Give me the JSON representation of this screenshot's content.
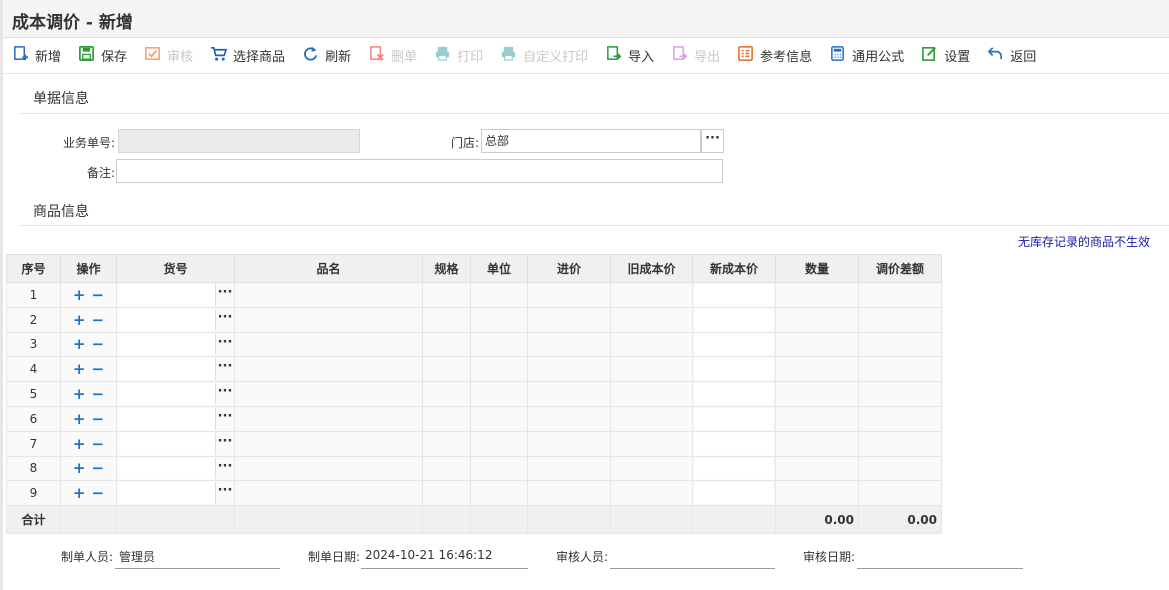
{
  "window": {
    "title": "成本调价 - 新增"
  },
  "toolbar": [
    {
      "label": "新增",
      "icon": "add-doc-icon",
      "color": "#2a6ebd",
      "disabled": false
    },
    {
      "label": "保存",
      "icon": "save-icon",
      "color": "#2e9a3c",
      "disabled": false
    },
    {
      "label": "审核",
      "icon": "audit-icon",
      "color": "#f0a070",
      "disabled": true
    },
    {
      "label": "选择商品",
      "icon": "cart-icon",
      "color": "#2a5fb0",
      "disabled": false
    },
    {
      "label": "刷新",
      "icon": "refresh-icon",
      "color": "#2a6ebd",
      "disabled": false
    },
    {
      "label": "删单",
      "icon": "delete-doc-icon",
      "color": "#e88",
      "disabled": true
    },
    {
      "label": "打印",
      "icon": "print-icon",
      "color": "#9cc",
      "disabled": true
    },
    {
      "label": "自定义打印",
      "icon": "custom-print-icon",
      "color": "#9cc",
      "disabled": true
    },
    {
      "label": "导入",
      "icon": "import-icon",
      "color": "#2e9a3c",
      "disabled": false
    },
    {
      "label": "导出",
      "icon": "export-icon",
      "color": "#d9a0e8",
      "disabled": true
    },
    {
      "label": "参考信息",
      "icon": "reference-icon",
      "color": "#e06a2a",
      "disabled": false
    },
    {
      "label": "通用公式",
      "icon": "formula-icon",
      "color": "#2a6ebd",
      "disabled": false
    },
    {
      "label": "设置",
      "icon": "settings-icon",
      "color": "#2e9a3c",
      "disabled": false
    },
    {
      "label": "返回",
      "icon": "return-icon",
      "color": "#2a6ebd",
      "disabled": false
    }
  ],
  "doc": {
    "section_title": "单据信息",
    "order_no_label": "业务单号:",
    "order_no": "",
    "store_label": "门店:",
    "store": "总部",
    "remark_label": "备注:",
    "remark": ""
  },
  "goods": {
    "section_title": "商品信息",
    "note": "无库存记录的商品不生效",
    "columns": [
      "序号",
      "操作",
      "货号",
      "品名",
      "规格",
      "单位",
      "进价",
      "旧成本价",
      "新成本价",
      "数量",
      "调价差额"
    ],
    "rows": [
      "1",
      "2",
      "3",
      "4",
      "5",
      "6",
      "7",
      "8",
      "9"
    ],
    "total_label": "合计",
    "total_qty": "0.00",
    "total_diff": "0.00",
    "add_glyph": "+",
    "remove_glyph": "−",
    "more_glyph": "···"
  },
  "footer": {
    "creator_label": "制单人员:",
    "creator": "管理员",
    "created_label": "制单日期:",
    "created": "2024-10-21 16:46:12",
    "auditor_label": "审核人员:",
    "auditor": "",
    "audit_date_label": "审核日期:",
    "audit_date": ""
  }
}
